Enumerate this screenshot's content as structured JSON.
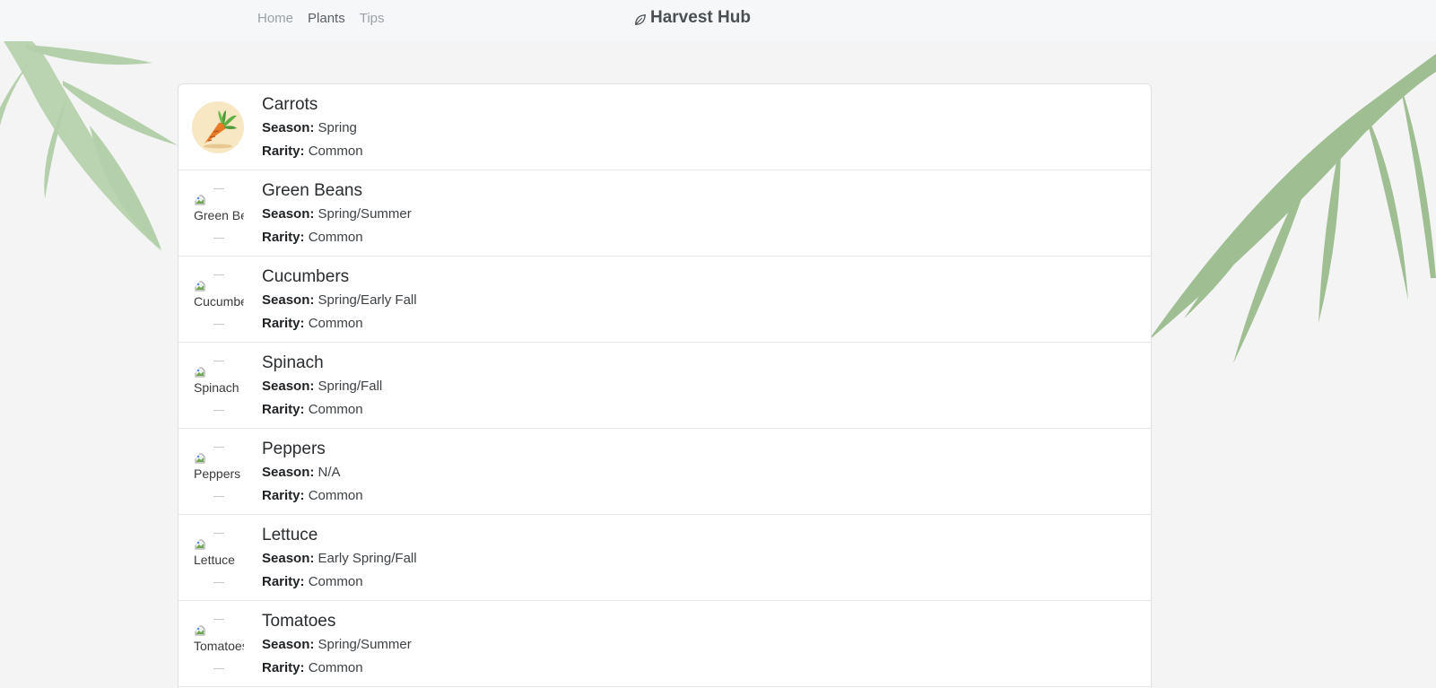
{
  "nav": {
    "links": [
      {
        "label": "Home",
        "active": false
      },
      {
        "label": "Plants",
        "active": true
      },
      {
        "label": "Tips",
        "active": false
      }
    ],
    "brand": {
      "icon": "leaf-icon",
      "title": "Harvest Hub"
    }
  },
  "plant_list": {
    "season_label": "Season:",
    "rarity_label": "Rarity:",
    "items": [
      {
        "name": "Carrots",
        "season": "Spring",
        "rarity": "Common",
        "image_alt": "",
        "image_icon": "carrot-icon"
      },
      {
        "name": "Green Beans",
        "season": "Spring/Summer",
        "rarity": "Common",
        "image_alt": "Green Beans",
        "image_icon": "broken-image-icon"
      },
      {
        "name": "Cucumbers",
        "season": "Spring/Early Fall",
        "rarity": "Common",
        "image_alt": "Cucumbers",
        "image_icon": "broken-image-icon"
      },
      {
        "name": "Spinach",
        "season": "Spring/Fall",
        "rarity": "Common",
        "image_alt": "Spinach",
        "image_icon": "broken-image-icon"
      },
      {
        "name": "Peppers",
        "season": "N/A",
        "rarity": "Common",
        "image_alt": "Peppers",
        "image_icon": "broken-image-icon"
      },
      {
        "name": "Lettuce",
        "season": "Early Spring/Fall",
        "rarity": "Common",
        "image_alt": "Lettuce",
        "image_icon": "broken-image-icon"
      },
      {
        "name": "Tomatoes",
        "season": "Spring/Summer",
        "rarity": "Common",
        "image_alt": "Tomatoes",
        "image_icon": "broken-image-icon"
      }
    ]
  },
  "colors": {
    "background": "#f4f4f4",
    "leaf": "#a9c79f",
    "carrot_bg": "#f8e7c3"
  }
}
